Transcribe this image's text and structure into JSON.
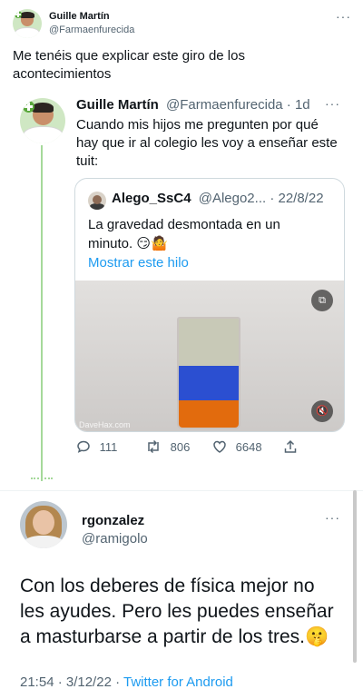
{
  "top_tweet": {
    "display_name": "Guille Martín",
    "handle": "@Farmaenfurecida",
    "more": "···",
    "text_line1": "Me tenéis que explicar este giro de los",
    "text_line2": "acontecimientos"
  },
  "quoted_tweet": {
    "display_name": "Guille Martín",
    "handle_time": "@Farmaenfurecida · 1d",
    "more": "···",
    "text_line1": "Cuando mis hijos me pregunten por qué",
    "text_line2": "hay que ir al colegio les voy a enseñar este",
    "text_line3": "tuit:",
    "inner_quote": {
      "display_name": "Alego_SsC4",
      "handle_date": "@Alego2... · 22/8/22",
      "text_line1": "La gravedad desmontada en un",
      "text_line2": "minuto. 😏🤷",
      "show_thread": "Mostrar este hilo",
      "watermark": "DaveHax.com"
    },
    "actions": {
      "replies": "111",
      "retweets": "806",
      "likes": "6648"
    }
  },
  "reply_tweet": {
    "display_name": "rgonzalez",
    "handle": "@ramigolo",
    "more": "···",
    "text_line1": "Con los deberes de física mejor no",
    "text_line2": "les ayudes. Pero les puedes enseñar",
    "text_line3": "a masturbarse a partir de los tres.🤫",
    "timestamp": "21:54 · 3/12/22 · ",
    "source": "Twitter for Android"
  },
  "colors": {
    "link": "#1d9bf0",
    "thread_line": "#a5d99a",
    "text": "#0f1419",
    "muted": "#536471"
  }
}
